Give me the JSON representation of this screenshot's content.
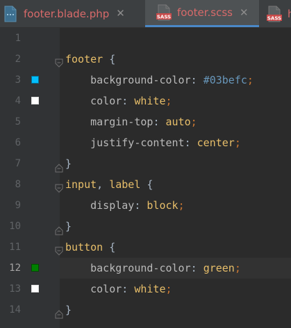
{
  "tabs": [
    {
      "label": "footer.blade.php",
      "icon": "php-file-icon",
      "close": "✕",
      "active": false
    },
    {
      "label": "footer.scss",
      "icon": "sass-file-icon",
      "icon_text": "SASS",
      "close": "✕",
      "active": true
    },
    {
      "label": "h",
      "icon": "sass-file-icon",
      "icon_text": "SASS",
      "active": false
    }
  ],
  "editor": {
    "current_line": 12,
    "colors": {
      "selector": "#e8bf6a",
      "property": "#bababa",
      "value": "#e8bf6a",
      "hex_value": "#6897bb",
      "semicolon": "#cc7832"
    },
    "lines": [
      {
        "n": "1"
      },
      {
        "n": "2",
        "selector": "footer",
        "brace": " {"
      },
      {
        "n": "3",
        "indent": "    ",
        "prop": "background-color",
        "colon": ": ",
        "value": "#03befc",
        "semi": ";",
        "swatch": "#03befc"
      },
      {
        "n": "4",
        "indent": "    ",
        "prop": "color",
        "colon": ": ",
        "value": "white",
        "semi": ";",
        "swatch": "#ffffff"
      },
      {
        "n": "5",
        "indent": "    ",
        "prop": "margin-top",
        "colon": ": ",
        "value": "auto",
        "semi": ";"
      },
      {
        "n": "6",
        "indent": "    ",
        "prop": "justify-content",
        "colon": ": ",
        "value": "center",
        "semi": ";"
      },
      {
        "n": "7",
        "close": "}"
      },
      {
        "n": "8",
        "selector": "input",
        "comma": ", ",
        "selector2": "label",
        "brace": " {"
      },
      {
        "n": "9",
        "indent": "    ",
        "prop": "display",
        "colon": ": ",
        "value": "block",
        "semi": ";"
      },
      {
        "n": "10",
        "close": "}"
      },
      {
        "n": "11",
        "selector": "button",
        "brace": " {"
      },
      {
        "n": "12",
        "indent": "    ",
        "prop": "background-color",
        "colon": ": ",
        "value": "green",
        "semi": ";",
        "swatch": "#008000"
      },
      {
        "n": "13",
        "indent": "    ",
        "prop": "color",
        "colon": ": ",
        "value": "white",
        "semi": ";",
        "swatch": "#ffffff"
      },
      {
        "n": "14",
        "close": "}"
      }
    ]
  }
}
